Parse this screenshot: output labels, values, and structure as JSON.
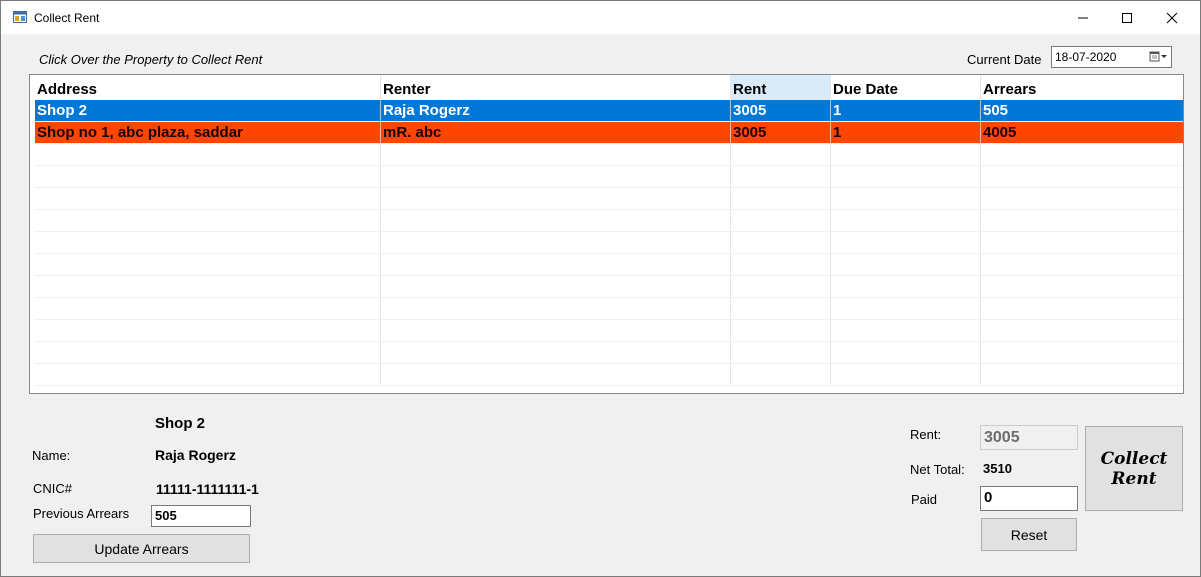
{
  "window": {
    "title": "Collect Rent"
  },
  "hint": "Click Over the Property to Collect Rent",
  "current_date": {
    "label": "Current Date",
    "value": "18-07-2020"
  },
  "grid": {
    "columns": [
      "Address",
      "Renter",
      "Rent",
      "Due Date",
      "Arrears"
    ],
    "rows": [
      [
        "Shop 2",
        "Raja Rogerz",
        "3005",
        "1",
        "505"
      ],
      [
        "Shop no 1, abc plaza, saddar",
        "mR. abc",
        "3005",
        "1",
        "4005"
      ]
    ]
  },
  "details": {
    "property": "Shop 2",
    "name_label": "Name:",
    "name_value": "Raja Rogerz",
    "cnic_label": "CNIC#",
    "cnic_value": "11111-1111111-1",
    "prev_arrears_label": "Previous Arrears",
    "prev_arrears_value": "505",
    "update_button": "Update Arrears"
  },
  "payment": {
    "rent_label": "Rent:",
    "rent_value": "3005",
    "net_total_label": "Net Total:",
    "net_total_value": "3510",
    "paid_label": "Paid",
    "paid_value": "0",
    "reset_button": "Reset",
    "collect_line1": "Collect",
    "collect_line2": "Rent"
  },
  "colors": {
    "selected_row": "#0078d7",
    "overdue_row": "#ff4500",
    "selected_header": "#d9ebf9"
  }
}
